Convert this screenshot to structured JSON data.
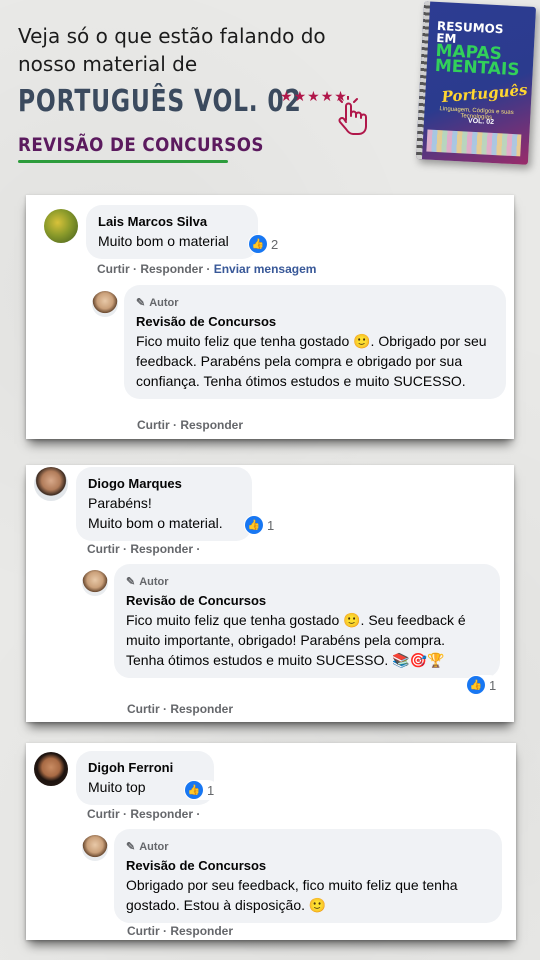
{
  "header": {
    "intro": "Veja só o que estão falando do nosso material de",
    "title": "PORTUGUÊS VOL. 02",
    "subtitle": "REVISÃO DE CONCURSOS"
  },
  "book": {
    "line1": "RESUMOS",
    "line2": "EM",
    "line3": "MAPAS",
    "line4": "MENTAIS",
    "script": "Português",
    "tagline": "Linguagem, Códigos e suas Tecnologias",
    "volume": "VOL. 02"
  },
  "comments": [
    {
      "name": "Lais Marcos Silva",
      "text": "Muito bom o material",
      "reactions": "2",
      "actions": {
        "like": "Curtir",
        "reply": "Responder",
        "message": "Enviar mensagem"
      },
      "reply": {
        "badge": "Autor",
        "name": "Revisão de Concursos",
        "text": "Fico muito feliz que tenha gostado 🙂. Obrigado por seu feedback. Parabéns pela compra e obrigado por sua confiança. Tenha ótimos estudos e muito SUCESSO.",
        "actions": {
          "like": "Curtir",
          "reply": "Responder"
        }
      }
    },
    {
      "name": "Diogo Marques",
      "text_line1": "Parabéns!",
      "text_line2": "Muito bom o material.",
      "reactions": "1",
      "actions": {
        "like": "Curtir",
        "reply": "Responder"
      },
      "reply": {
        "badge": "Autor",
        "name": "Revisão de Concursos",
        "text": "Fico muito feliz que tenha gostado 🙂. Seu feedback é muito importante, obrigado! Parabéns pela compra. Tenha ótimos estudos e muito SUCESSO. 📚🎯🏆",
        "reactions": "1",
        "actions": {
          "like": "Curtir",
          "reply": "Responder"
        }
      }
    },
    {
      "name": "Digoh Ferroni",
      "text": "Muito top",
      "reactions": "1",
      "actions": {
        "like": "Curtir",
        "reply": "Responder"
      },
      "reply": {
        "badge": "Autor",
        "name": "Revisão de Concursos",
        "text": "Obrigado por seu feedback, fico muito feliz que tenha gostado. Estou à disposição. 🙂",
        "actions": {
          "like": "Curtir",
          "reply": "Responder"
        }
      }
    }
  ],
  "colors": {
    "title": "#3b4a5e",
    "subtitle": "#5b1a5e",
    "underline": "#2d9c3c",
    "stars": "#b0174a",
    "like": "#1877f2"
  }
}
